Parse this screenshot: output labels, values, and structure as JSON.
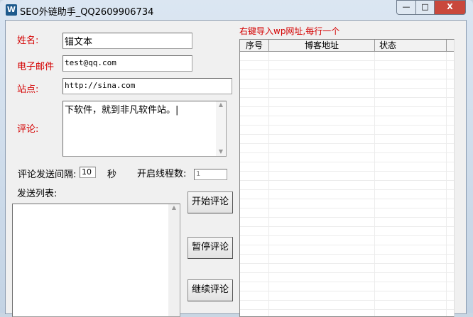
{
  "window": {
    "title": "SEO外链助手_QQ2609906734",
    "minimize": "—",
    "maximize": "□",
    "close": "X"
  },
  "form": {
    "name_label": "姓名:",
    "name_value": "锚文本",
    "email_label": "电子邮件",
    "email_value": "test@qq.com",
    "site_label": "站点:",
    "site_value": "http://sina.com",
    "comment_label": "评论:",
    "comment_value": "下软件，就到非凡软件站。|",
    "interval_label": "评论发送间隔:",
    "interval_value": "10",
    "interval_unit": "秒",
    "threads_label": "开启线程数:",
    "threads_value": "1",
    "send_list_label": "发送列表:"
  },
  "buttons": {
    "start": "开始评论",
    "pause": "暂停评论",
    "resume": "继续评论"
  },
  "blog_list": {
    "hint": "右键导入wp网址,每行一个",
    "columns": [
      "序号",
      "博客地址",
      "状态"
    ]
  }
}
